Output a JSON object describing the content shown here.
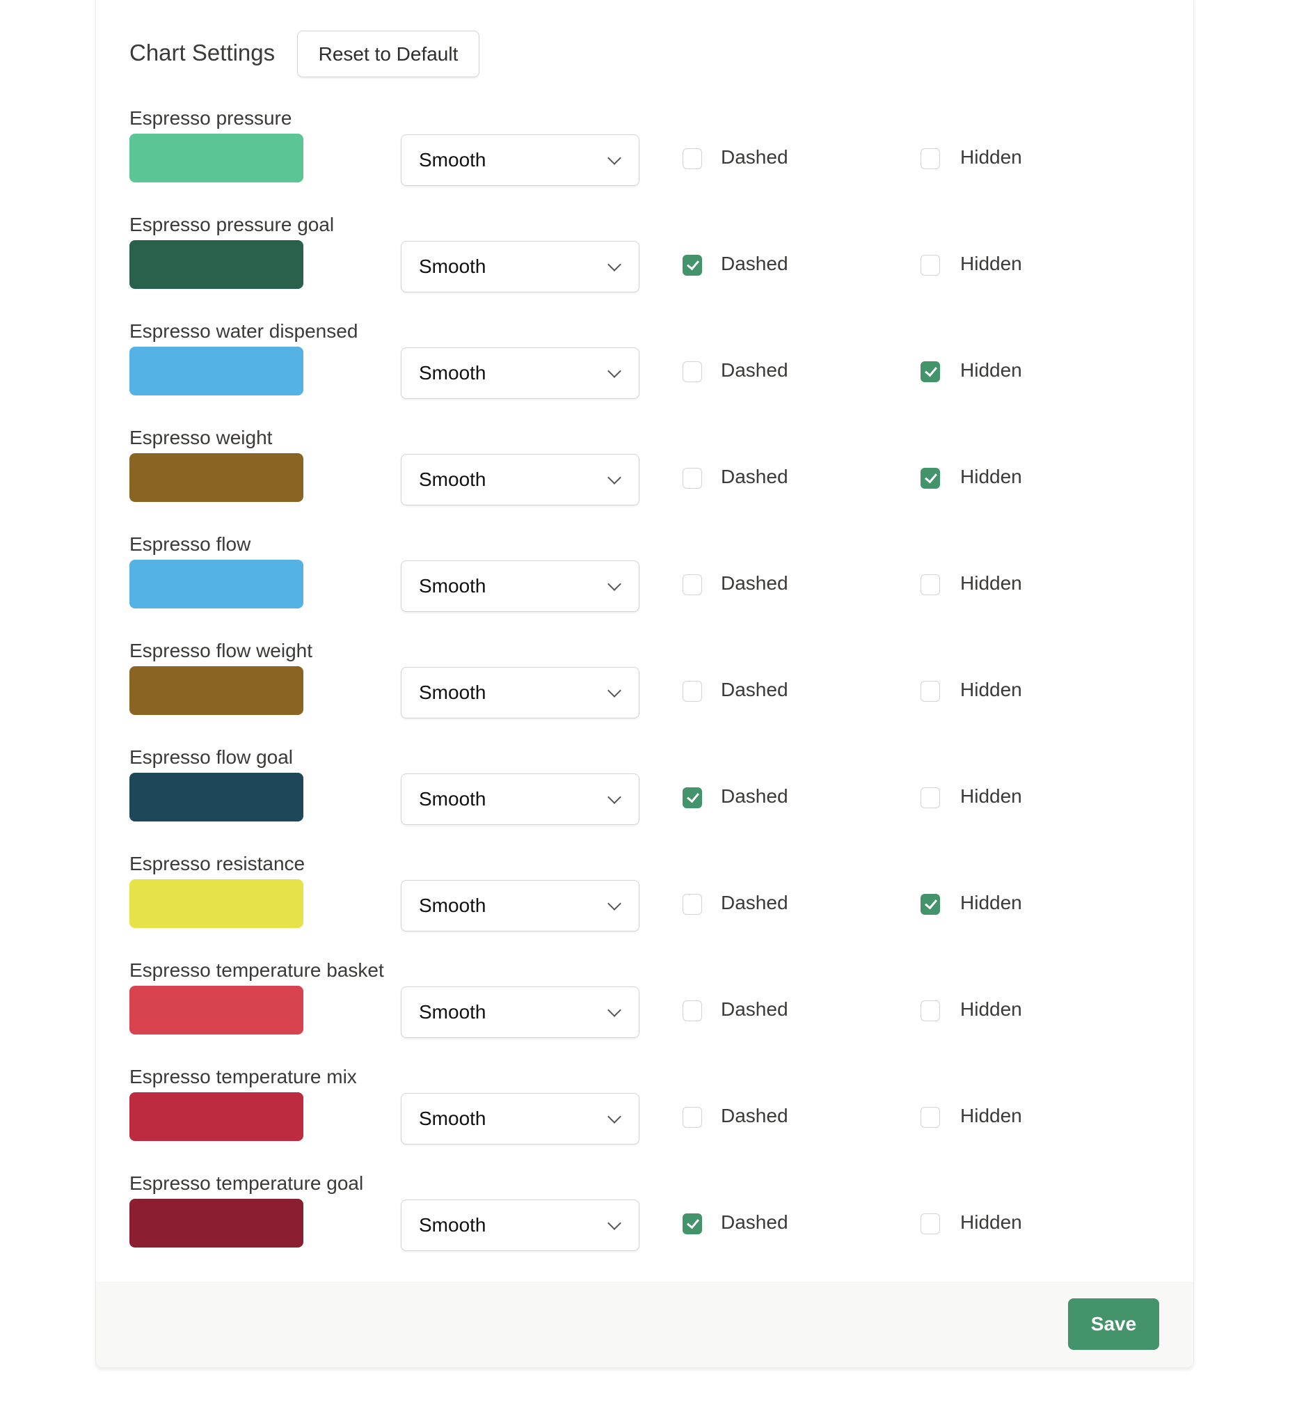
{
  "header": {
    "title": "Chart Settings",
    "reset_label": "Reset to Default"
  },
  "labels": {
    "dashed": "Dashed",
    "hidden": "Hidden"
  },
  "series": [
    {
      "name": "Espresso pressure",
      "color": "#5bc595",
      "curve": "Smooth",
      "dashed": false,
      "hidden": false
    },
    {
      "name": "Espresso pressure goal",
      "color": "#2a614d",
      "curve": "Smooth",
      "dashed": true,
      "hidden": false
    },
    {
      "name": "Espresso water dispensed",
      "color": "#55b2e4",
      "curve": "Smooth",
      "dashed": false,
      "hidden": true
    },
    {
      "name": "Espresso weight",
      "color": "#8a6422",
      "curve": "Smooth",
      "dashed": false,
      "hidden": true
    },
    {
      "name": "Espresso flow",
      "color": "#55b2e4",
      "curve": "Smooth",
      "dashed": false,
      "hidden": false
    },
    {
      "name": "Espresso flow weight",
      "color": "#8a6422",
      "curve": "Smooth",
      "dashed": false,
      "hidden": false
    },
    {
      "name": "Espresso flow goal",
      "color": "#1e475a",
      "curve": "Smooth",
      "dashed": true,
      "hidden": false
    },
    {
      "name": "Espresso resistance",
      "color": "#e6e34a",
      "curve": "Smooth",
      "dashed": false,
      "hidden": true
    },
    {
      "name": "Espresso temperature basket",
      "color": "#d7434f",
      "curve": "Smooth",
      "dashed": false,
      "hidden": false
    },
    {
      "name": "Espresso temperature mix",
      "color": "#bd2b40",
      "curve": "Smooth",
      "dashed": false,
      "hidden": false
    },
    {
      "name": "Espresso temperature goal",
      "color": "#8b1f31",
      "curve": "Smooth",
      "dashed": true,
      "hidden": false
    }
  ],
  "footer": {
    "save_label": "Save"
  },
  "colors": {
    "accent": "#43936b"
  }
}
